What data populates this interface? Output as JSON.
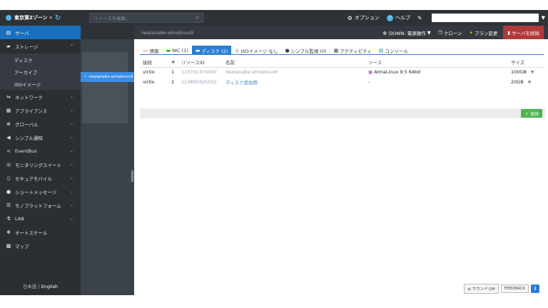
{
  "topbar": {
    "zone_label": "東京第2ゾーン",
    "search_placeholder": "リソースを検索...",
    "options_label": "オプション",
    "help_label": "ヘルプ"
  },
  "sidebar": {
    "items": [
      {
        "label": "サーバ",
        "icon": "server-icon"
      },
      {
        "label": "ストレージ",
        "icon": "storage-icon"
      },
      {
        "label": "ディスク"
      },
      {
        "label": "アーカイブ"
      },
      {
        "label": "ISOイメージ"
      },
      {
        "label": "ネットワーク",
        "icon": "network-icon"
      },
      {
        "label": "アプライアンス",
        "icon": "appliance-icon"
      },
      {
        "label": "グローバル",
        "icon": "globe-icon"
      },
      {
        "label": "シンプル通知",
        "icon": "megaphone-icon"
      },
      {
        "label": "EventBus",
        "icon": "share-icon"
      },
      {
        "label": "モニタリングスイート",
        "icon": "binoculars-icon"
      },
      {
        "label": "セキュアモバイル",
        "icon": "mobile-icon"
      },
      {
        "label": "ショートメッセージ",
        "icon": "chat-icon"
      },
      {
        "label": "モノプラットフォーム",
        "icon": "layers-icon"
      },
      {
        "label": "LAB",
        "icon": "flask-icon"
      },
      {
        "label": "オートスケール",
        "icon": "autoscale-icon"
      },
      {
        "label": "マップ",
        "icon": "map-icon"
      }
    ],
    "lang_ja": "日本語",
    "lang_sep": "|",
    "lang_en": "English"
  },
  "server_list": {
    "selected": "rwatanabe-almalinux9"
  },
  "main": {
    "server_name": "rwatanabe-almalinux9",
    "status_label": "DOWN: 電源操作",
    "clone_label": "クローン",
    "plan_label": "プラン変更",
    "delete_label": "サーバを削除",
    "tabs": [
      {
        "label": "情報",
        "icon": "info-icon"
      },
      {
        "label": "NIC (1)",
        "icon": "nic-icon"
      },
      {
        "label": "ディスク (2)",
        "icon": "disk-icon"
      },
      {
        "label": "ISOイメージ なし",
        "icon": "cd-icon"
      },
      {
        "label": "シンプル監視 (0)",
        "icon": "monitor-icon"
      },
      {
        "label": "アクティビティ",
        "icon": "activity-icon"
      },
      {
        "label": "コンソール",
        "icon": "console-icon"
      }
    ],
    "table": {
      "headers": [
        "接続",
        "#",
        "リソースID",
        "名前",
        "ソース",
        "サイズ"
      ],
      "rows": [
        {
          "conn": "virtio",
          "num": "1",
          "id": "113701374430",
          "name": "rwatanabe-almalinux9",
          "source": "AlmaLinux 9.5 64bit",
          "size": "100GB"
        },
        {
          "conn": "virtio",
          "num": "2",
          "id": "113800425552",
          "name": "ディスク追加用",
          "source": "-",
          "size": "20GB"
        }
      ]
    },
    "connect_label": "接続"
  },
  "footer": {
    "sound_label": "サウンド:Off",
    "feedback_label": "FEEDBACK"
  }
}
